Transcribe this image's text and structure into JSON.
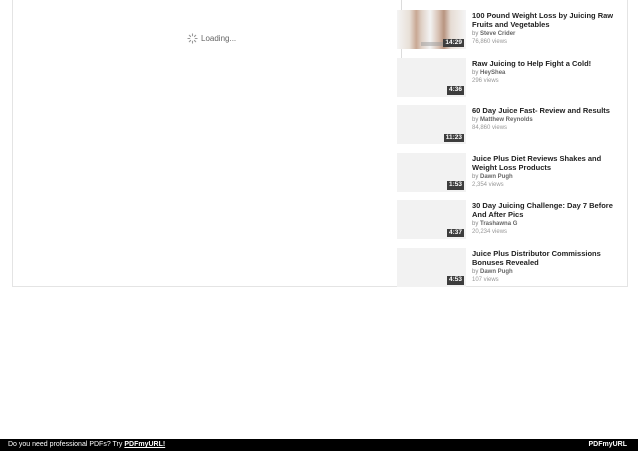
{
  "player": {
    "loading_text": "Loading..."
  },
  "related_videos": [
    {
      "title": "100 Pound Weight Loss by Juicing Raw Fruits and Vegetables",
      "by_prefix": "by",
      "author": "Steve Crider",
      "views": "76,860 views",
      "duration": "14:29",
      "has_thumbnail": true
    },
    {
      "title": "Raw Juicing to Help Fight a Cold!",
      "by_prefix": "by",
      "author": "HeyShea",
      "views": "296 views",
      "duration": "4:36",
      "has_thumbnail": false
    },
    {
      "title": "60 Day Juice Fast- Review and Results",
      "by_prefix": "by",
      "author": "Matthew Reynolds",
      "views": "84,860 views",
      "duration": "11:23",
      "has_thumbnail": false
    },
    {
      "title": "Juice Plus Diet Reviews Shakes and Weight Loss Products",
      "by_prefix": "by",
      "author": "Dawn Pugh",
      "views": "2,354 views",
      "duration": "1:53",
      "has_thumbnail": false
    },
    {
      "title": "30 Day Juicing Challenge: Day 7 Before And After Pics",
      "by_prefix": "by",
      "author": "Trashawna G",
      "views": "20,234 views",
      "duration": "4:37",
      "has_thumbnail": false
    },
    {
      "title": "Juice Plus Distributor Commissions Bonuses Revealed",
      "by_prefix": "by",
      "author": "Dawn Pugh",
      "views": "107 views",
      "duration": "4:53",
      "has_thumbnail": false
    }
  ],
  "footer": {
    "prompt": "Do you need professional PDFs? Try ",
    "link": "PDFmyURL!",
    "logo": "PDFmyURL"
  }
}
